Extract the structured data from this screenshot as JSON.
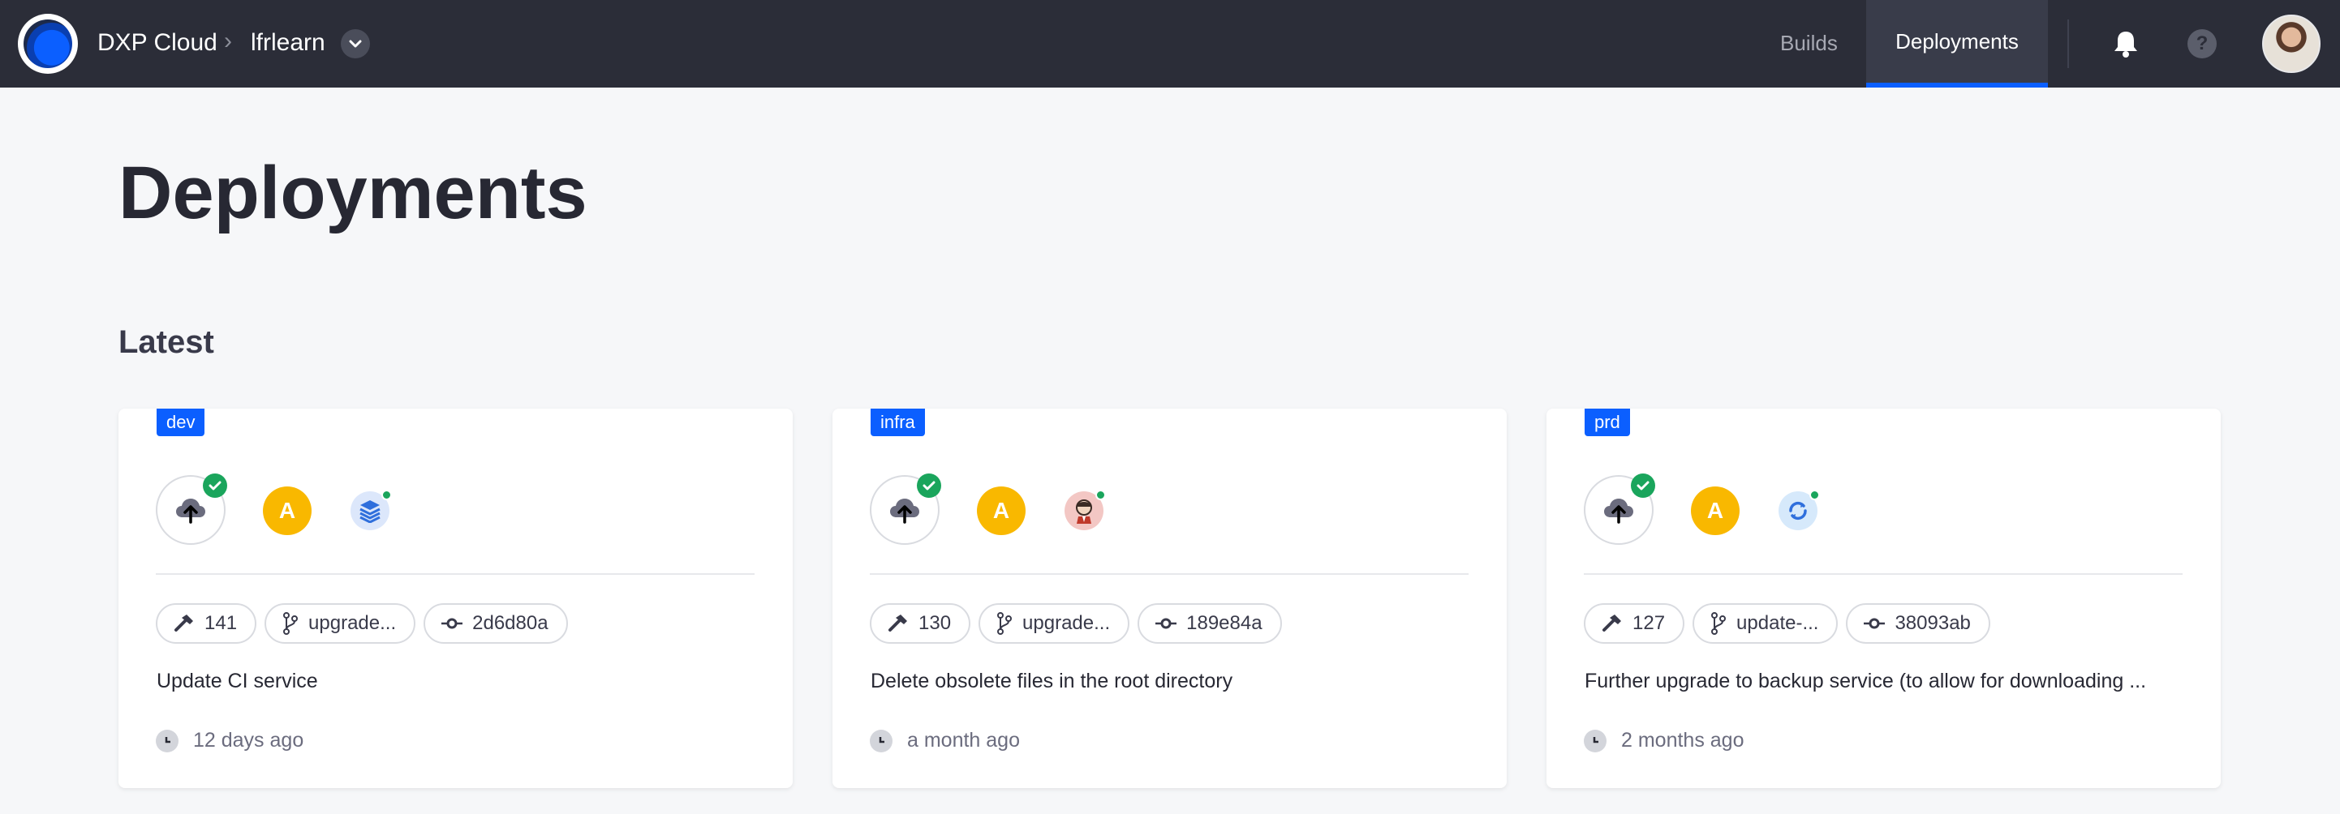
{
  "header": {
    "app_name": "DXP Cloud",
    "breadcrumb_separator": "›",
    "project_name": "lfrlearn",
    "nav": {
      "builds": "Builds",
      "deployments": "Deployments"
    },
    "help_label": "?"
  },
  "page": {
    "title": "Deployments",
    "section_title": "Latest"
  },
  "deployments": [
    {
      "environment": "dev",
      "author_initial": "A",
      "service_icon": "stacked-layers-icon",
      "build_number": "141",
      "branch": "upgrade...",
      "commit": "2d6d80a",
      "message": "Update CI service",
      "time": "12 days ago"
    },
    {
      "environment": "infra",
      "author_initial": "A",
      "service_icon": "jenkins-icon",
      "build_number": "130",
      "branch": "upgrade...",
      "commit": "189e84a",
      "message": "Delete obsolete files in the root directory",
      "time": "a month ago"
    },
    {
      "environment": "prd",
      "author_initial": "A",
      "service_icon": "backup-sync-icon",
      "build_number": "127",
      "branch": "update-...",
      "commit": "38093ab",
      "message": "Further upgrade to backup service (to allow for downloading ...",
      "time": "2 months ago"
    }
  ],
  "colors": {
    "topbar": "#2b2d38",
    "accent": "#0b5fff",
    "success": "#1aa55c",
    "author_avatar": "#f9b800"
  }
}
